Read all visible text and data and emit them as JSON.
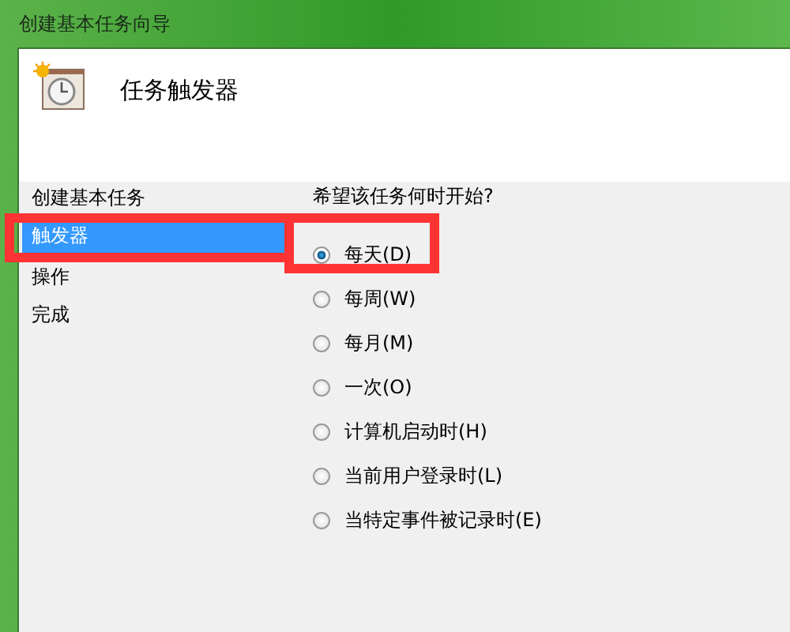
{
  "window": {
    "title": "创建基本任务向导"
  },
  "header": {
    "title": "任务触发器"
  },
  "sidebar": {
    "items": [
      {
        "label": "创建基本任务",
        "selected": false
      },
      {
        "label": "触发器",
        "selected": true
      },
      {
        "label": "操作",
        "selected": false
      },
      {
        "label": "完成",
        "selected": false
      }
    ]
  },
  "question": "希望该任务何时开始?",
  "options": [
    {
      "label": "每天(D)",
      "selected": true
    },
    {
      "label": "每周(W)",
      "selected": false
    },
    {
      "label": "每月(M)",
      "selected": false
    },
    {
      "label": "一次(O)",
      "selected": false
    },
    {
      "label": "计算机启动时(H)",
      "selected": false
    },
    {
      "label": "当前用户登录时(L)",
      "selected": false
    },
    {
      "label": "当特定事件被记录时(E)",
      "selected": false
    }
  ]
}
